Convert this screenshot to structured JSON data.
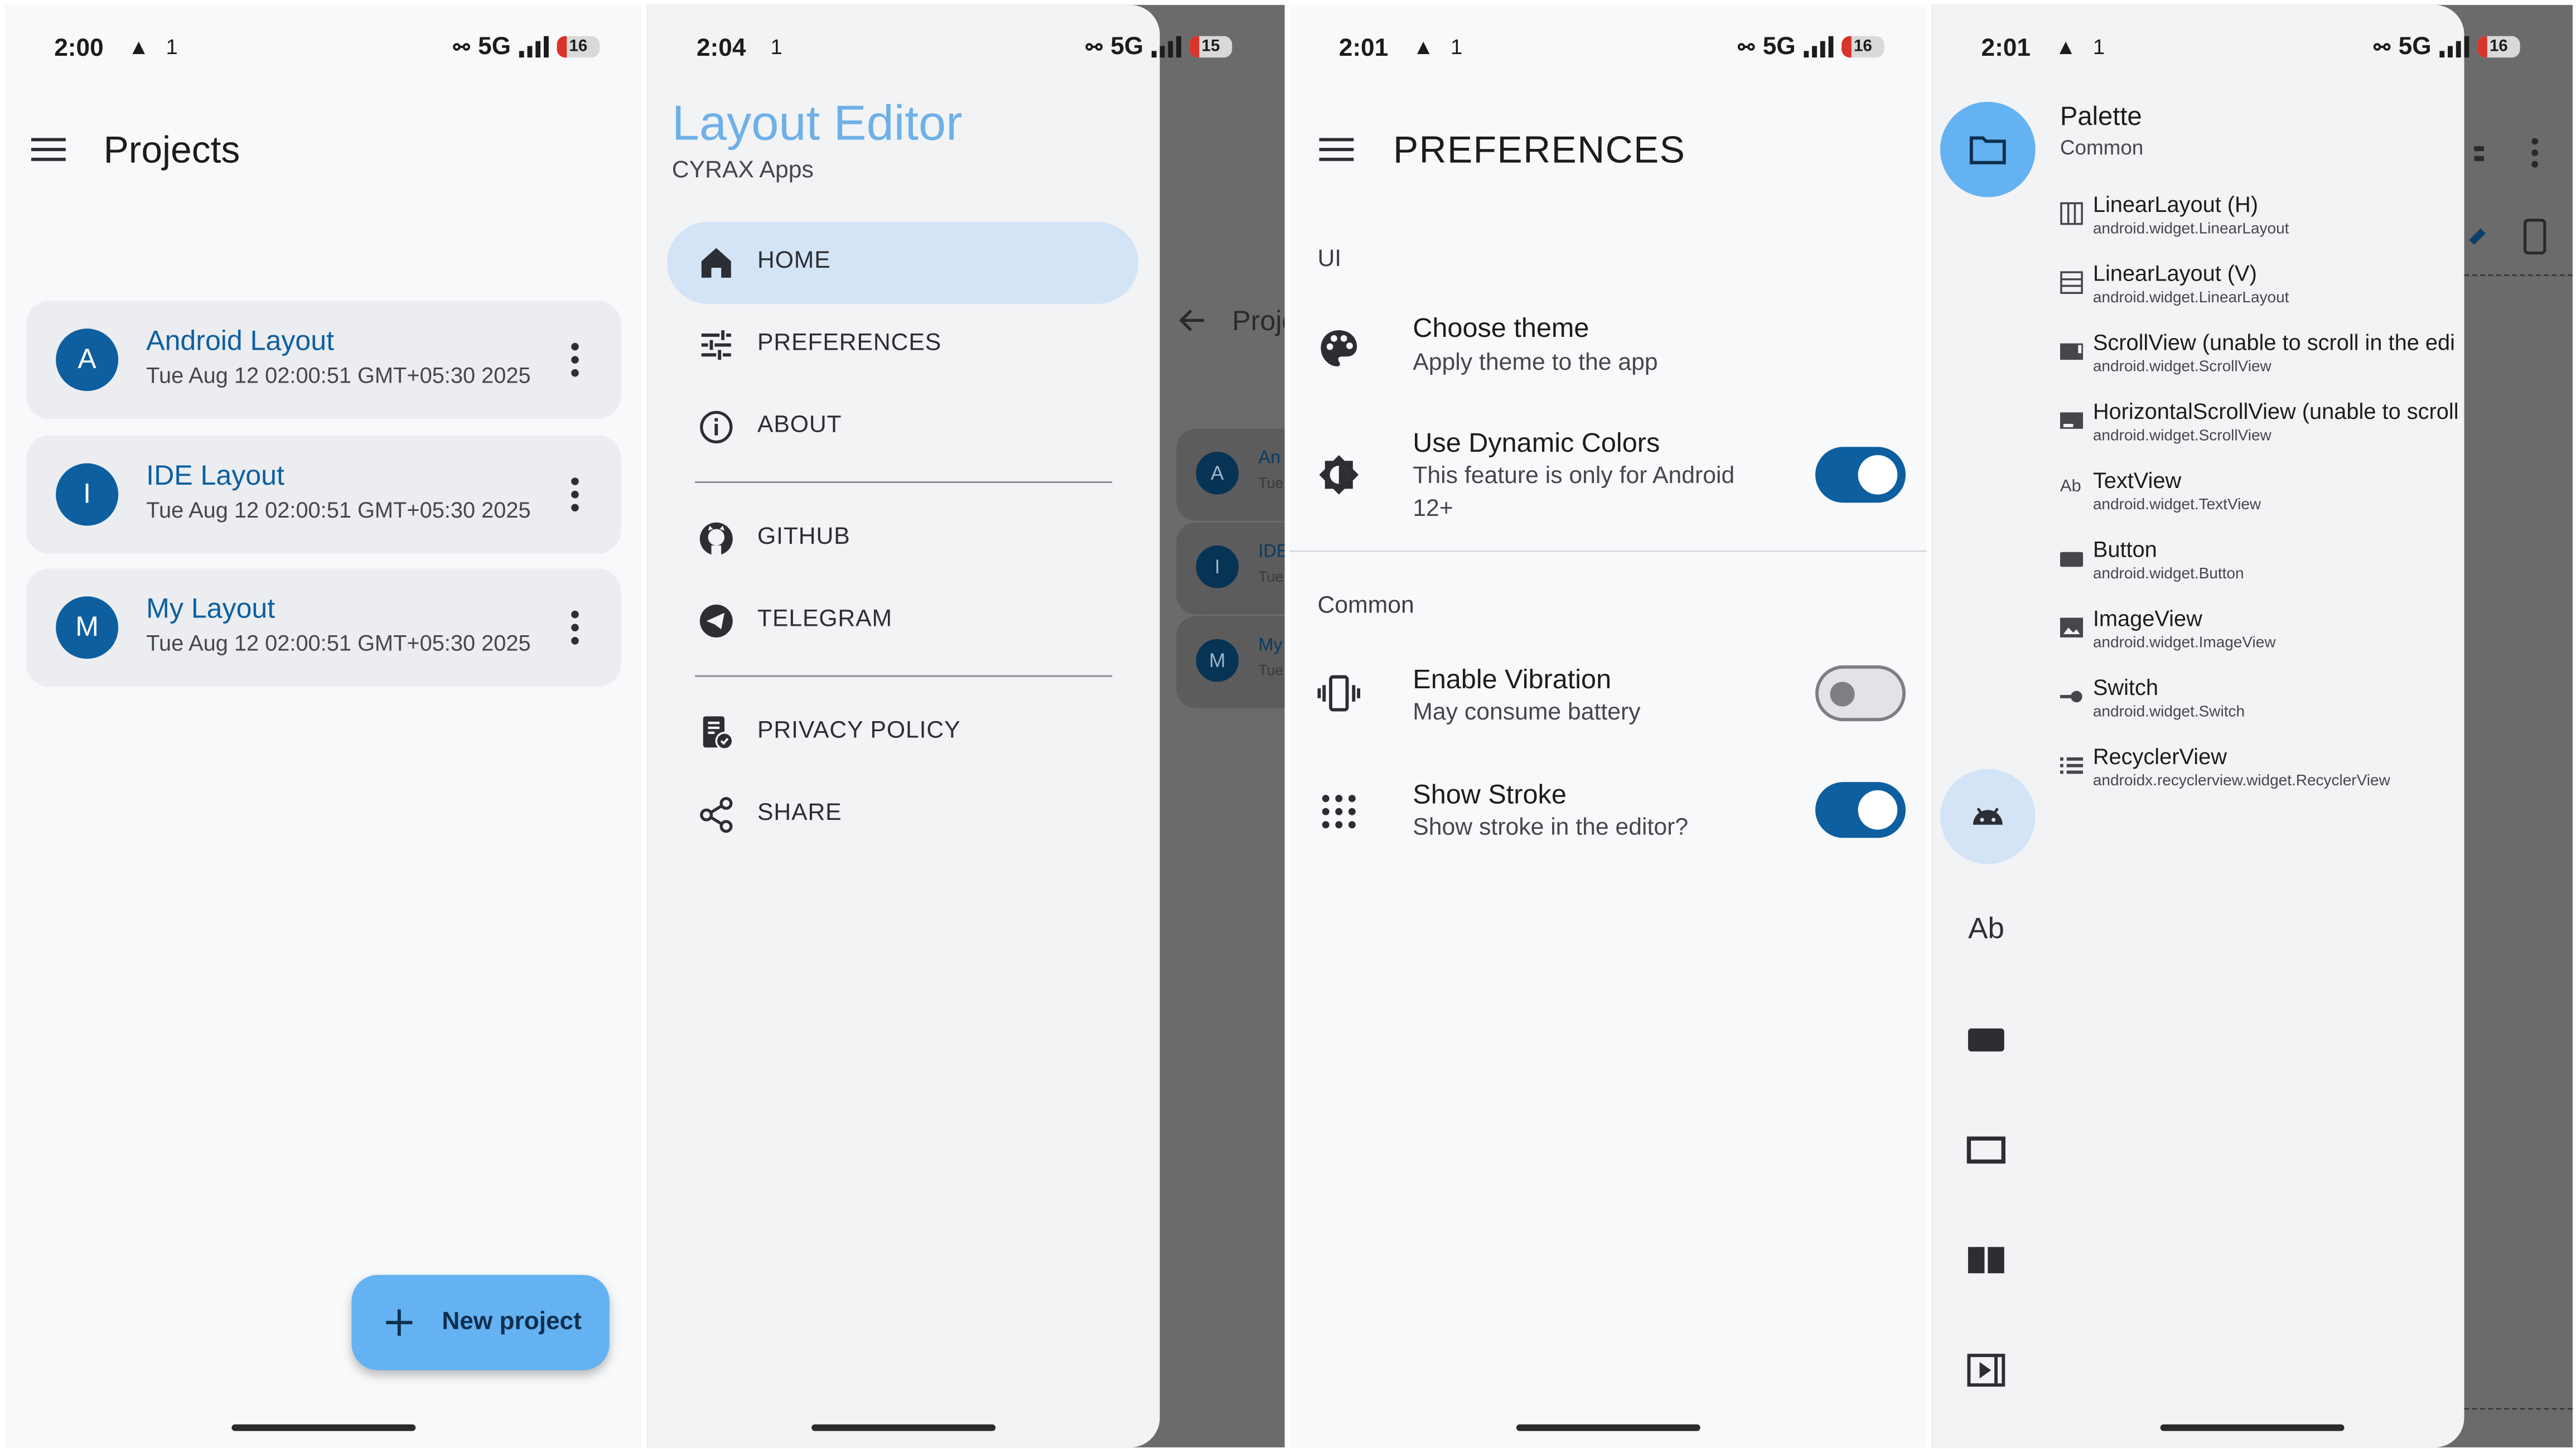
{
  "screen1": {
    "status": {
      "time": "2:00",
      "network": "5G",
      "battery": "16"
    },
    "title": "Projects",
    "projects": [
      {
        "initial": "A",
        "name": "Android Layout",
        "date": "Tue Aug 12 02:00:51 GMT+05:30 2025"
      },
      {
        "initial": "I",
        "name": "IDE Layout",
        "date": "Tue Aug 12 02:00:51 GMT+05:30 2025"
      },
      {
        "initial": "M",
        "name": "My Layout",
        "date": "Tue Aug 12 02:00:51 GMT+05:30 2025"
      }
    ],
    "fab_label": "New project"
  },
  "screen2": {
    "status": {
      "time": "2:04",
      "network": "5G",
      "battery": "15"
    },
    "app_title": "Layout Editor",
    "app_subtitle": "CYRAX Apps",
    "items": [
      {
        "label": "HOME",
        "icon": "home-icon"
      },
      {
        "label": "PREFERENCES",
        "icon": "tune-icon"
      },
      {
        "label": "ABOUT",
        "icon": "info-icon"
      },
      {
        "label": "GITHUB",
        "icon": "github-icon"
      },
      {
        "label": "TELEGRAM",
        "icon": "telegram-icon"
      },
      {
        "label": "PRIVACY POLICY",
        "icon": "policy-icon"
      },
      {
        "label": "SHARE",
        "icon": "share-icon"
      }
    ],
    "background": {
      "title_fragment": "Proje",
      "initials": [
        "A",
        "I",
        "M"
      ],
      "name_fragments": [
        "An",
        "IDE",
        "My"
      ],
      "date_fragment": "Tue"
    }
  },
  "screen3": {
    "status": {
      "time": "2:01",
      "network": "5G",
      "battery": "16"
    },
    "title": "PREFERENCES",
    "sections": {
      "ui": "UI",
      "common": "Common"
    },
    "prefs": {
      "theme": {
        "title": "Choose theme",
        "subtitle": "Apply theme to the app"
      },
      "dynamic": {
        "title": "Use Dynamic Colors",
        "subtitle_1": "This feature is only for Android",
        "subtitle_2": "12+",
        "enabled": true
      },
      "vibration": {
        "title": "Enable Vibration",
        "subtitle": "May consume battery",
        "enabled": false
      },
      "stroke": {
        "title": "Show Stroke",
        "subtitle": "Show stroke in the editor?",
        "enabled": true
      }
    }
  },
  "screen4": {
    "status": {
      "time": "2:01",
      "network": "5G",
      "battery": "16"
    },
    "palette_title": "Palette",
    "palette_category": "Common",
    "items": [
      {
        "name": "LinearLayout (H)",
        "cls": "android.widget.LinearLayout",
        "icon": "linear-horizontal-icon"
      },
      {
        "name": "LinearLayout (V)",
        "cls": "android.widget.LinearLayout",
        "icon": "linear-vertical-icon"
      },
      {
        "name": "ScrollView (unable to scroll in the edi",
        "cls": "android.widget.ScrollView",
        "icon": "scrollview-icon"
      },
      {
        "name": "HorizontalScrollView (unable to scroll",
        "cls": "android.widget.ScrollView",
        "icon": "hscrollview-icon"
      },
      {
        "name": "TextView",
        "cls": "android.widget.TextView",
        "icon": "textview-icon"
      },
      {
        "name": "Button",
        "cls": "android.widget.Button",
        "icon": "button-icon"
      },
      {
        "name": "ImageView",
        "cls": "android.widget.ImageView",
        "icon": "image-icon"
      },
      {
        "name": "Switch",
        "cls": "android.widget.Switch",
        "icon": "switch-icon"
      },
      {
        "name": "RecyclerView",
        "cls": "androidx.recyclerview.widget.RecyclerView",
        "icon": "list-icon"
      }
    ],
    "rail_text_label": "Ab"
  },
  "colors": {
    "primary": "#0d5fa0",
    "fab": "#64b2f2",
    "drawer_active": "#d4e4f7",
    "rail_active": "#64b2f2",
    "scrim": "#6b6b6b"
  }
}
